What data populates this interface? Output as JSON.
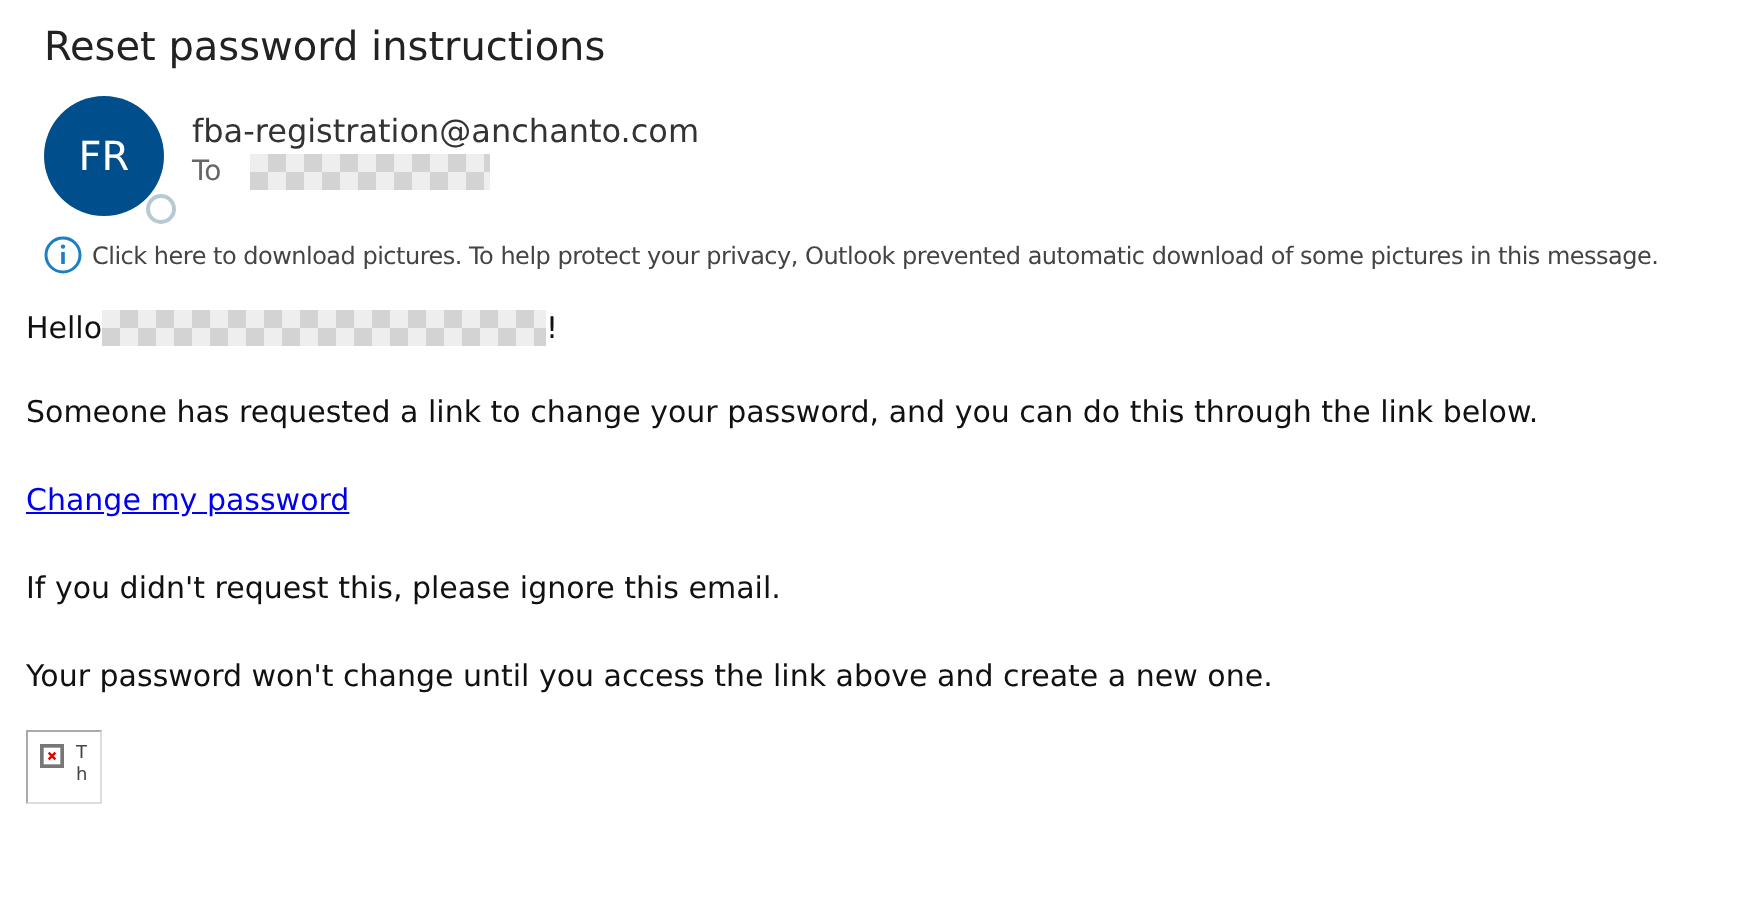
{
  "subject": "Reset password instructions",
  "sender": {
    "initials": "FR",
    "address": "fba-registration@anchanto.com",
    "to_label": "To"
  },
  "info_bar": {
    "text": "Click here to download pictures. To help protect your privacy, Outlook prevented automatic download of some pictures in this message."
  },
  "body": [
    {
      "kind": "greeting",
      "text": "Hello",
      "after": "!"
    },
    {
      "kind": "paragraph",
      "text": "Someone has requested a link to change your password, and you can do this through the link below."
    },
    {
      "kind": "link",
      "text": "Change my password"
    },
    {
      "kind": "paragraph",
      "text": "If you didn't request this, please ignore this email."
    },
    {
      "kind": "paragraph",
      "text": "Your password won't change until you access the link above and create a new one."
    }
  ],
  "broken_image": {
    "alt_lines": [
      "T",
      "h"
    ]
  }
}
